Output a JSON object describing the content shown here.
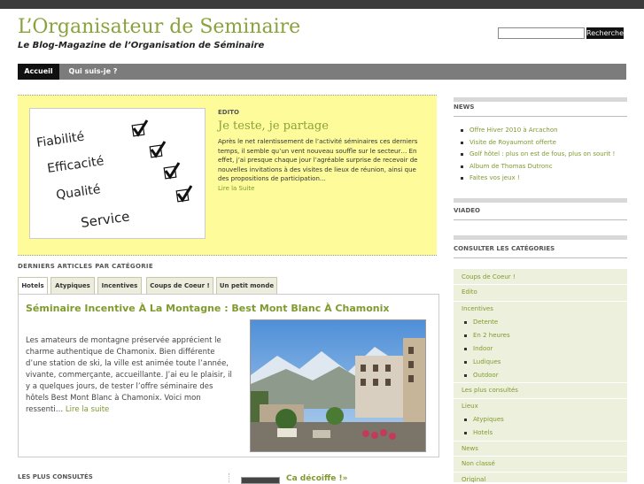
{
  "header": {
    "site_title": "L’Organisateur de Seminaire",
    "tagline": "Le Blog-Magazine de l’Organisation de Séminaire",
    "search_button": "Recherche"
  },
  "nav": {
    "items": [
      "Accueil",
      "Qui suis-je ?"
    ]
  },
  "edito": {
    "label": "EDITO",
    "title": "Je teste, je partage",
    "excerpt": "Après le net ralentissement de l’activité séminaires ces derniers temps, il semble qu’un vent nouveau souffle sur le secteur… En effet, j’ai presque chaque jour l’agréable surprise de recevoir de nouvelles invitations à des visites de lieux de réunion, ainsi que des propositions de participation…",
    "more": "Lire la Suite",
    "image_words": [
      "Fiabilité",
      "Efficacité",
      "Qualité",
      "Service"
    ]
  },
  "recent": {
    "label": "DERNIERS ARTICLES PAR CATÉGORIE",
    "tabs": [
      "Hotels",
      "Atypiques",
      "Incentives",
      "Coups de Coeur !",
      "Un petit monde"
    ],
    "post_title": "Séminaire Incentive À La Montagne : Best Mont Blanc À Chamonix",
    "post_text": "Les amateurs de montagne préservée apprécient le charme authentique de Chamonix. Bien différente d’une station de ski, la ville est animée toute l’année, vivante, commerçante, accueillante. J’ai eu le plaisir, il y a quelques jours, de tester l’offre séminaire des hôtels Best Mont Blanc à Chamonix. Voici mon ressenti…",
    "post_more": "Lire la suite"
  },
  "bottom": {
    "most_viewed_label": "LES PLUS CONSULTÉS",
    "featured_link": "Ca décoiffe !»"
  },
  "sidebar": {
    "news_title": "NEWS",
    "news_items": [
      "Offre Hiver 2010 à Arcachon",
      "Visite de Royaumont offerte",
      "Golf hôtel : plus on est de fous, plus on sourit !",
      "Album de Thomas Dutronc",
      "Faites vos jeux !"
    ],
    "video_title": "VIADEO",
    "categories_title": "CONSULTER LES CATÉGORIES",
    "categories": [
      {
        "label": "Coups de Coeur !",
        "level": 0
      },
      {
        "label": "Edito",
        "level": 0
      },
      {
        "label": "Incentives",
        "level": 0
      },
      {
        "label": "Detente",
        "level": 1
      },
      {
        "label": "En 2 heures",
        "level": 1
      },
      {
        "label": "Indoor",
        "level": 1
      },
      {
        "label": "Ludiques",
        "level": 1
      },
      {
        "label": "Outdoor",
        "level": 1
      },
      {
        "label": "Les plus consultés",
        "level": 0
      },
      {
        "label": "Lieux",
        "level": 0
      },
      {
        "label": "Atypiques",
        "level": 1
      },
      {
        "label": "Hotels",
        "level": 1
      },
      {
        "label": "News",
        "level": 0
      },
      {
        "label": "Non classé",
        "level": 0
      },
      {
        "label": "Original",
        "level": 0
      }
    ]
  },
  "colors": {
    "accent": "#7f9a2e",
    "edito_bg": "#fdfb9a",
    "nav_bg": "#7c7c7c",
    "topbar": "#3b3b3b"
  }
}
